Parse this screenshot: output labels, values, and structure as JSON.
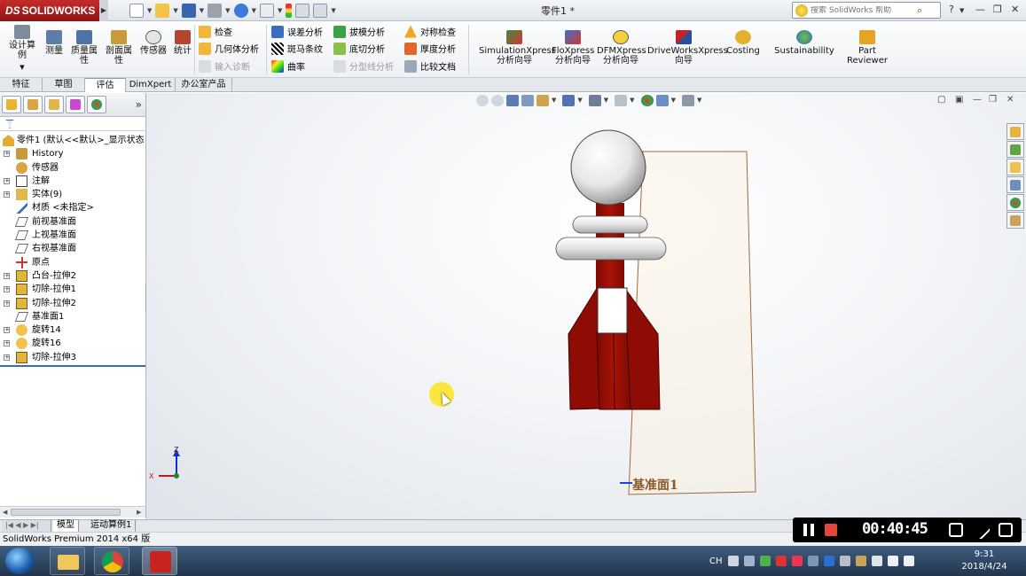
{
  "app": {
    "brand": "SOLIDWORKS",
    "brand_prefix": "DS",
    "document_title": "零件1 *",
    "search_placeholder": "搜索 SolidWorks 帮助",
    "help_label": "?"
  },
  "command_manager": {
    "large_tools": [
      {
        "label": "设计算例",
        "icon": "design-study-icon"
      },
      {
        "label": "测量",
        "icon": "measure-icon"
      },
      {
        "label": "质量属性",
        "icon": "mass-properties-icon"
      },
      {
        "label": "剖面属性",
        "icon": "section-properties-icon"
      },
      {
        "label": "传感器",
        "icon": "sensor-icon"
      },
      {
        "label": "统计",
        "icon": "statistics-icon"
      }
    ],
    "col1": [
      {
        "label": "检查",
        "enabled": true
      },
      {
        "label": "几何体分析",
        "enabled": true
      },
      {
        "label": "输入诊断",
        "enabled": false
      }
    ],
    "col2": [
      {
        "label": "误差分析",
        "enabled": true
      },
      {
        "label": "斑马条纹",
        "enabled": true
      },
      {
        "label": "曲率",
        "enabled": true
      }
    ],
    "col3": [
      {
        "label": "拔模分析",
        "enabled": true
      },
      {
        "label": "底切分析",
        "enabled": true
      },
      {
        "label": "分型线分析",
        "enabled": false
      }
    ],
    "col4": [
      {
        "label": "对称检查",
        "enabled": true
      },
      {
        "label": "厚度分析",
        "enabled": true
      },
      {
        "label": "比较文档",
        "enabled": true
      }
    ],
    "xpress_tools": [
      {
        "line1": "SimulationXpress",
        "line2": "分析向导"
      },
      {
        "line1": "FloXpress",
        "line2": "分析向导"
      },
      {
        "line1": "DFMXpress",
        "line2": "分析向导"
      },
      {
        "line1": "DriveWorksXpress",
        "line2": "向导"
      },
      {
        "line1": "Costing",
        "line2": ""
      },
      {
        "line1": "Sustainability",
        "line2": ""
      },
      {
        "line1": "Part",
        "line2": "Reviewer"
      }
    ]
  },
  "tabs": [
    "特征",
    "草图",
    "评估",
    "DimXpert",
    "办公室产品"
  ],
  "active_tab": "评估",
  "tree": {
    "root": "零件1 (默认<<默认>_显示状态",
    "items": [
      {
        "label": "History",
        "icon": "history-icon",
        "expandable": true
      },
      {
        "label": "传感器",
        "icon": "sensor-icon",
        "expandable": false
      },
      {
        "label": "注解",
        "icon": "annotation-icon",
        "expandable": true
      },
      {
        "label": "实体(9)",
        "icon": "solid-bodies-icon",
        "expandable": true
      },
      {
        "label": "材质 <未指定>",
        "icon": "material-icon",
        "expandable": false
      },
      {
        "label": "前视基准面",
        "icon": "plane-icon",
        "expandable": false
      },
      {
        "label": "上视基准面",
        "icon": "plane-icon",
        "expandable": false
      },
      {
        "label": "右视基准面",
        "icon": "plane-icon",
        "expandable": false
      },
      {
        "label": "原点",
        "icon": "origin-icon",
        "expandable": false
      },
      {
        "label": "凸台-拉伸2",
        "icon": "extrude-icon",
        "expandable": true
      },
      {
        "label": "切除-拉伸1",
        "icon": "cut-extrude-icon",
        "expandable": true
      },
      {
        "label": "切除-拉伸2",
        "icon": "cut-extrude-icon",
        "expandable": true
      },
      {
        "label": "基准面1",
        "icon": "plane-icon",
        "expandable": false
      },
      {
        "label": "旋转14",
        "icon": "revolve-icon",
        "expandable": true
      },
      {
        "label": "旋转16",
        "icon": "revolve-icon",
        "expandable": true
      },
      {
        "label": "切除-拉伸3",
        "icon": "cut-extrude-icon",
        "expandable": true
      }
    ]
  },
  "bottom_tabs": [
    "模型",
    "运动算例1"
  ],
  "status": "SolidWorks Premium 2014 x64 版",
  "viewport": {
    "plane_label": "基准面1",
    "triad": {
      "z": "Z",
      "x": "X"
    }
  },
  "recorder": {
    "time": "00:40:45"
  },
  "taskbar": {
    "lang": "CH",
    "time": "9:31",
    "date": "2018/4/24"
  },
  "colors": {
    "brand_red": "#b11f1f",
    "model_red": "#9b0f05",
    "model_white": "#f2f2f2",
    "plane_edge": "#a06a3c"
  }
}
